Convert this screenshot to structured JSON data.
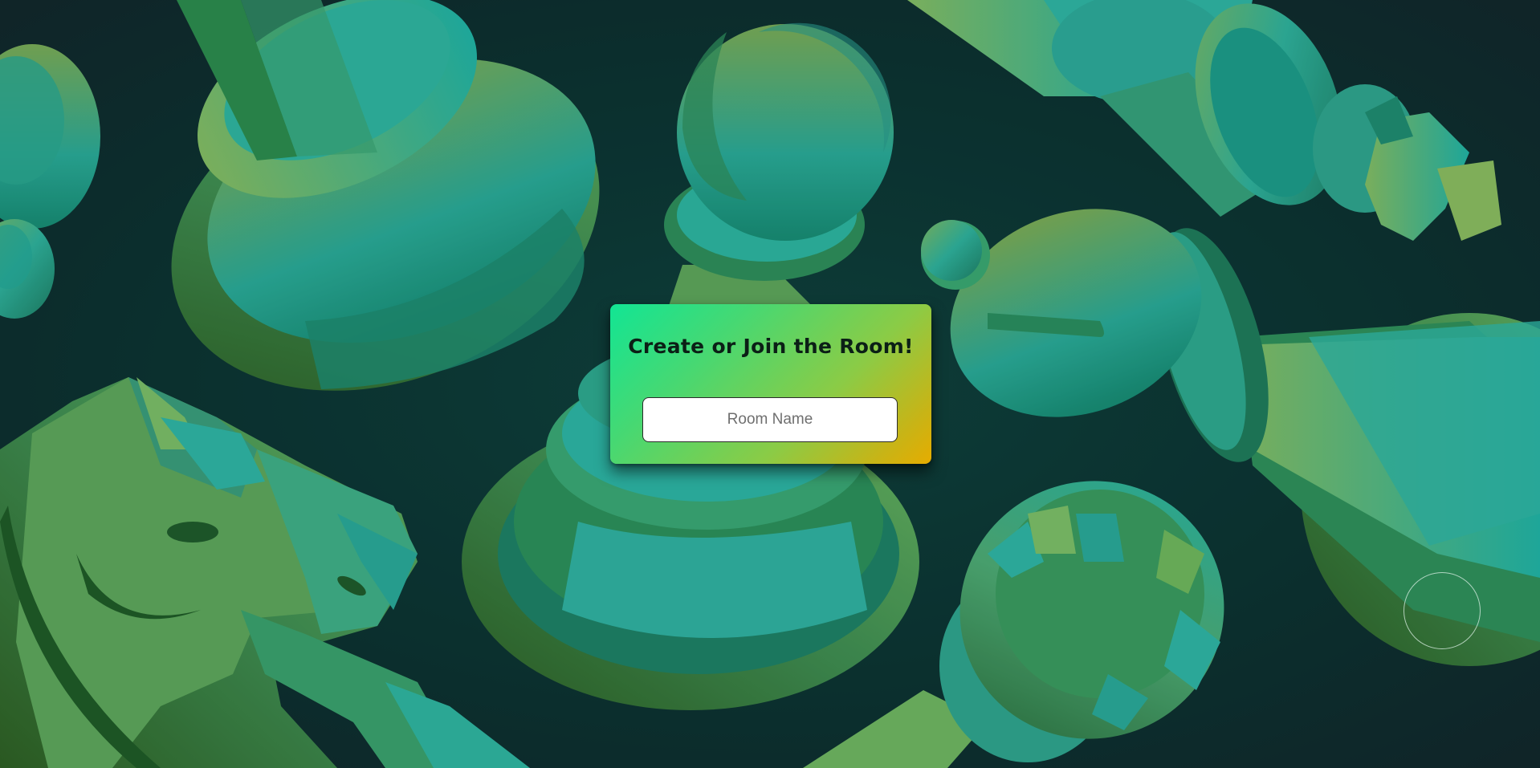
{
  "room_card": {
    "title": "Create or Join the Room!",
    "input_value": "",
    "input_placeholder": "Room Name"
  },
  "background": {
    "pieces": [
      "queen-icon",
      "pawn-icon",
      "king-icon",
      "bishop-icon",
      "knight-icon",
      "rook-icon"
    ],
    "colors": {
      "backdrop": "#0c3230",
      "piece_teal": "#22b3a2",
      "piece_green": "#6bb25c",
      "piece_dark": "#1f7a58"
    }
  },
  "colors": {
    "card_gradient_start": "#12e594",
    "card_gradient_end": "#e6ac00",
    "title_text": "#0b1f16"
  }
}
